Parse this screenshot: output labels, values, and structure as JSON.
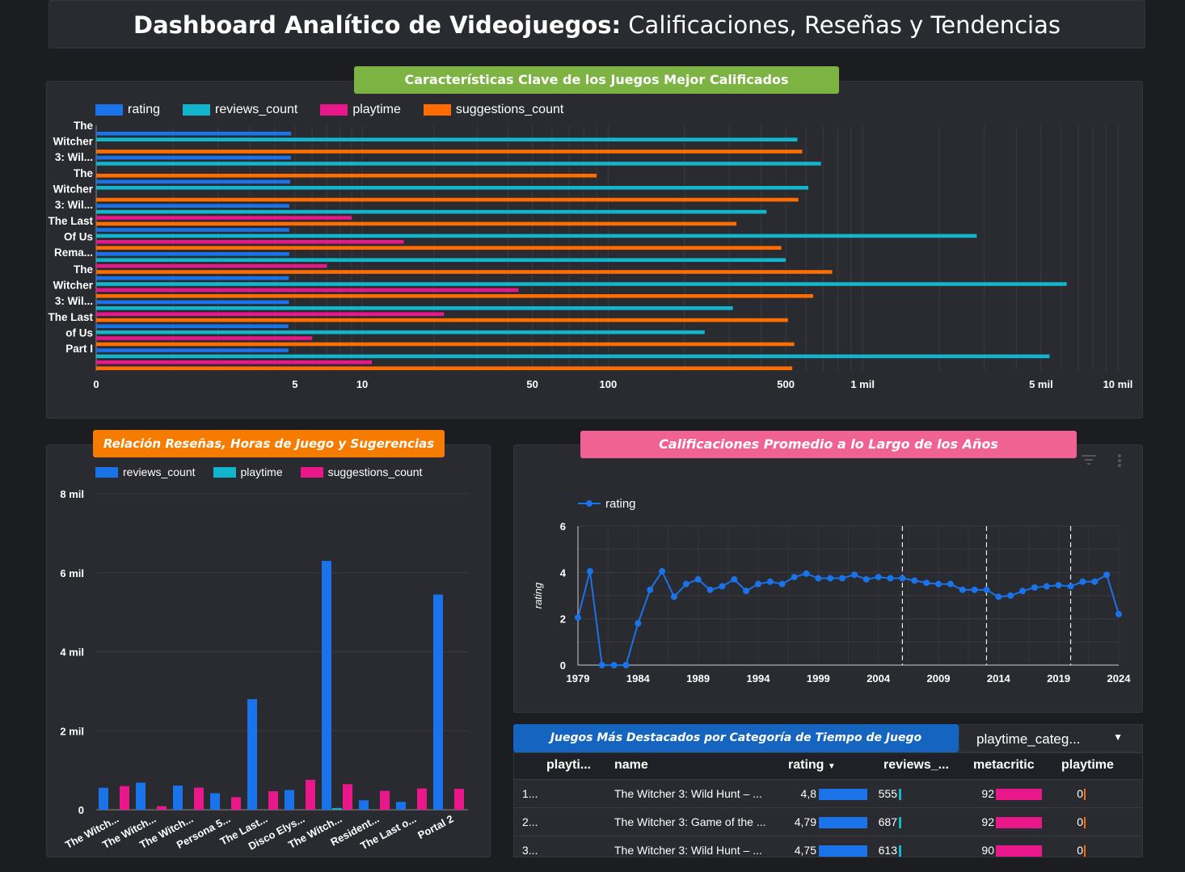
{
  "header": {
    "title_bold": "Dashboard Analítico de Videojuegos:",
    "title_rest": " Calificaciones, Reseñas y Tendencias"
  },
  "colors": {
    "blue": "#1a73e8",
    "cyan": "#12b5cb",
    "pink": "#e8178a",
    "orange": "#ff6d01",
    "green_pill": "#7cb342",
    "orange_pill": "#f57c00",
    "pink_pill": "#f06292",
    "blue_pill": "#1565c0"
  },
  "chart1": {
    "title": "Características Clave de los Juegos Mejor Calificados",
    "legend": [
      "rating",
      "reviews_count",
      "playtime",
      "suggestions_count"
    ],
    "category_labels": [
      [
        "The",
        "Witcher",
        "3: Wil..."
      ],
      [
        "The",
        "Witcher",
        "3: Wil..."
      ],
      [
        "The Last",
        "Of Us",
        "Rema..."
      ],
      [
        "The",
        "Witcher",
        "3: Wil..."
      ],
      [
        "The Last",
        "of Us",
        "Part I"
      ]
    ],
    "x_ticks": [
      "0",
      "5",
      "10",
      "50",
      "100",
      "500",
      "1 mil",
      "5 mil",
      "10 mil"
    ]
  },
  "chart2": {
    "title": "Relación Reseñas, Horas de Juego y Sugerencias",
    "legend": [
      "reviews_count",
      "playtime",
      "suggestions_count"
    ],
    "y_ticks": [
      "0",
      "2 mil",
      "4 mil",
      "6 mil",
      "8 mil"
    ],
    "x_labels": [
      "The Witch...",
      "The Witch...",
      "The Witch...",
      "Persona 5...",
      "The Last...",
      "Disco Elys...",
      "The Witch...",
      "Resident...",
      "The Last o...",
      "Portal 2"
    ]
  },
  "chart3": {
    "title": "Calificaciones Promedio a lo Largo de los Años",
    "legend": [
      "rating"
    ],
    "ylabel": "rating",
    "y_ticks": [
      "0",
      "2",
      "4",
      "6"
    ],
    "x_ticks": [
      "1979",
      "1984",
      "1989",
      "1994",
      "1999",
      "2004",
      "2009",
      "2014",
      "2019",
      "2024"
    ]
  },
  "chart_data": [
    {
      "type": "bar",
      "title": "Características Clave de los Juegos Mejor Calificados",
      "orientation": "horizontal",
      "x_scale": "log",
      "categories": [
        "The Witcher 3: Wil...",
        "The Witcher 3: Wil...",
        "The Last Of Us Rema...",
        "The Witcher 3: Wil...",
        "The Last of Us Part I"
      ],
      "rows": [
        {
          "rating": 4.8,
          "reviews_count": 555,
          "playtime": 0,
          "suggestions_count": 580
        },
        {
          "rating": 4.79,
          "reviews_count": 687,
          "playtime": 0,
          "suggestions_count": 90
        },
        {
          "rating": 4.75,
          "reviews_count": 613,
          "playtime": 0,
          "suggestions_count": 560
        },
        {
          "rating": 4.7,
          "reviews_count": 420,
          "playtime": 9,
          "suggestions_count": 320
        },
        {
          "rating": 4.7,
          "reviews_count": 2800,
          "playtime": 15,
          "suggestions_count": 480
        },
        {
          "rating": 4.7,
          "reviews_count": 500,
          "playtime": 7,
          "suggestions_count": 760
        },
        {
          "rating": 4.68,
          "reviews_count": 6300,
          "playtime": 44,
          "suggestions_count": 640
        },
        {
          "rating": 4.68,
          "reviews_count": 310,
          "playtime": 22,
          "suggestions_count": 510
        },
        {
          "rating": 4.65,
          "reviews_count": 240,
          "playtime": 6,
          "suggestions_count": 540
        },
        {
          "rating": 4.65,
          "reviews_count": 5400,
          "playtime": 11,
          "suggestions_count": 530
        }
      ],
      "xlim": [
        0,
        10000
      ]
    },
    {
      "type": "bar",
      "title": "Relación Reseñas, Horas de Juego y Sugerencias",
      "categories": [
        "The Witch...",
        "The Witch...",
        "The Witch...",
        "Persona 5...",
        "The Last...",
        "Disco Elys...",
        "The Witch...",
        "Resident...",
        "The Last o...",
        "Portal 2"
      ],
      "series": [
        {
          "name": "reviews_count",
          "values": [
            555,
            687,
            613,
            420,
            2800,
            500,
            6300,
            240,
            200,
            5450
          ]
        },
        {
          "name": "playtime",
          "values": [
            0,
            0,
            0,
            0,
            0,
            0,
            44,
            0,
            0,
            0
          ]
        },
        {
          "name": "suggestions_count",
          "values": [
            600,
            90,
            560,
            320,
            470,
            760,
            650,
            480,
            540,
            530
          ]
        }
      ],
      "ylim": [
        0,
        8000
      ]
    },
    {
      "type": "line",
      "title": "Calificaciones Promedio a lo Largo de los Años",
      "ylabel": "rating",
      "x": [
        1979,
        1980,
        1981,
        1982,
        1983,
        1984,
        1985,
        1986,
        1987,
        1988,
        1989,
        1990,
        1991,
        1992,
        1993,
        1994,
        1995,
        1996,
        1997,
        1998,
        1999,
        2000,
        2001,
        2002,
        2003,
        2004,
        2005,
        2006,
        2007,
        2008,
        2009,
        2010,
        2011,
        2012,
        2013,
        2014,
        2015,
        2016,
        2017,
        2018,
        2019,
        2020,
        2021,
        2022,
        2023,
        2024
      ],
      "series": [
        {
          "name": "rating",
          "values": [
            2.05,
            4.05,
            0,
            0,
            0,
            1.8,
            3.25,
            4.05,
            2.95,
            3.5,
            3.7,
            3.25,
            3.4,
            3.7,
            3.2,
            3.5,
            3.6,
            3.5,
            3.8,
            3.95,
            3.75,
            3.75,
            3.75,
            3.9,
            3.7,
            3.8,
            3.75,
            3.75,
            3.65,
            3.55,
            3.5,
            3.5,
            3.25,
            3.25,
            3.25,
            2.95,
            3.0,
            3.2,
            3.35,
            3.4,
            3.45,
            3.4,
            3.6,
            3.6,
            3.9,
            2.2
          ]
        }
      ],
      "ylim": [
        0,
        6
      ],
      "xlim": [
        1979,
        2024
      ],
      "reference_lines_x": [
        2006,
        2013,
        2020
      ]
    }
  ],
  "table": {
    "title": "Juegos Más Destacados  por Categoría de Tiempo de Juego",
    "dropdown": "playtime_categ...",
    "headers": [
      "playti...",
      "name",
      "rating",
      "reviews_...",
      "metacritic",
      "playtime"
    ],
    "rows": [
      {
        "idx": "1...",
        "name": "The Witcher 3: Wild Hunt – ...",
        "rating": "4,8",
        "rating_v": 4.8,
        "reviews": "555",
        "reviews_v": 555,
        "metacritic": "92",
        "meta_v": 92,
        "playtime": "0"
      },
      {
        "idx": "2...",
        "name": "The Witcher 3: Game of the ...",
        "rating": "4,79",
        "rating_v": 4.79,
        "reviews": "687",
        "reviews_v": 687,
        "metacritic": "92",
        "meta_v": 92,
        "playtime": "0"
      },
      {
        "idx": "3...",
        "name": "The Witcher 3: Wild Hunt – ...",
        "rating": "4,75",
        "rating_v": 4.75,
        "reviews": "613",
        "reviews_v": 613,
        "metacritic": "90",
        "meta_v": 90,
        "playtime": "0"
      }
    ]
  }
}
